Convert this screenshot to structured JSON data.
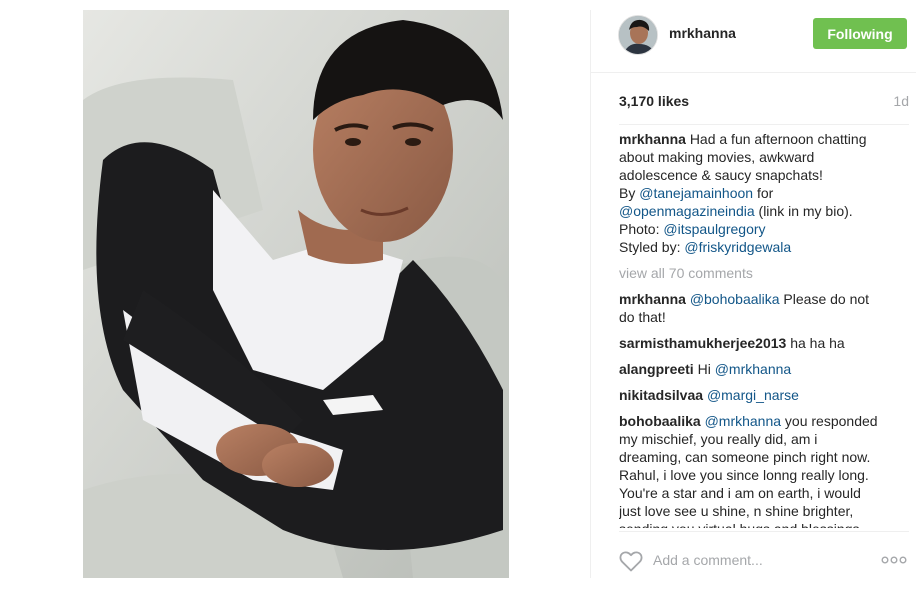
{
  "post": {
    "username": "mrkhanna",
    "follow_label": "Following",
    "likes": "3,170 likes",
    "time_ago": "1d",
    "caption": {
      "username": "mrkhanna",
      "line1": "Had a fun afternoon chatting about making movies, awkward adolescence & saucy snapchats!",
      "by_prefix": "By ",
      "by_mention": "@tanejamainhoon",
      "for_text": " for ",
      "mag_mention": "@openmagazineindia",
      "link_text": " (link in my bio).",
      "photo_prefix": "Photo: ",
      "photo_mention": "@itspaulgregory",
      "styled_prefix": "Styled by: ",
      "styled_mention": "@friskyridgewala"
    },
    "view_all": "view all 70 comments",
    "comments": [
      {
        "user": "mrkhanna",
        "mention": "@bohobaalika",
        "text": " Please do not do that!"
      },
      {
        "user": "sarmisthamukherjee2013",
        "mention": "",
        "text": "ha ha ha"
      },
      {
        "user": "alangpreeti",
        "mention": "",
        "text": "Hi ",
        "mention_after": "@mrkhanna"
      },
      {
        "user": "nikitadsilvaa",
        "mention": "@margi_narse",
        "text": ""
      },
      {
        "user": "bohobaalika",
        "mention": "@mrkhanna",
        "text": " you responded my mischief, you really did, am i dreaming, can someone pinch right now. Rahul, i love you since lonng really long. You're a star and i am on earth, i would just love see u shine, n shine brighter, sending you virtual hugs and blessings"
      }
    ],
    "add_comment_placeholder": "Add a comment...",
    "icons": {
      "heart": "heart-icon",
      "more": "more-options-icon"
    }
  }
}
